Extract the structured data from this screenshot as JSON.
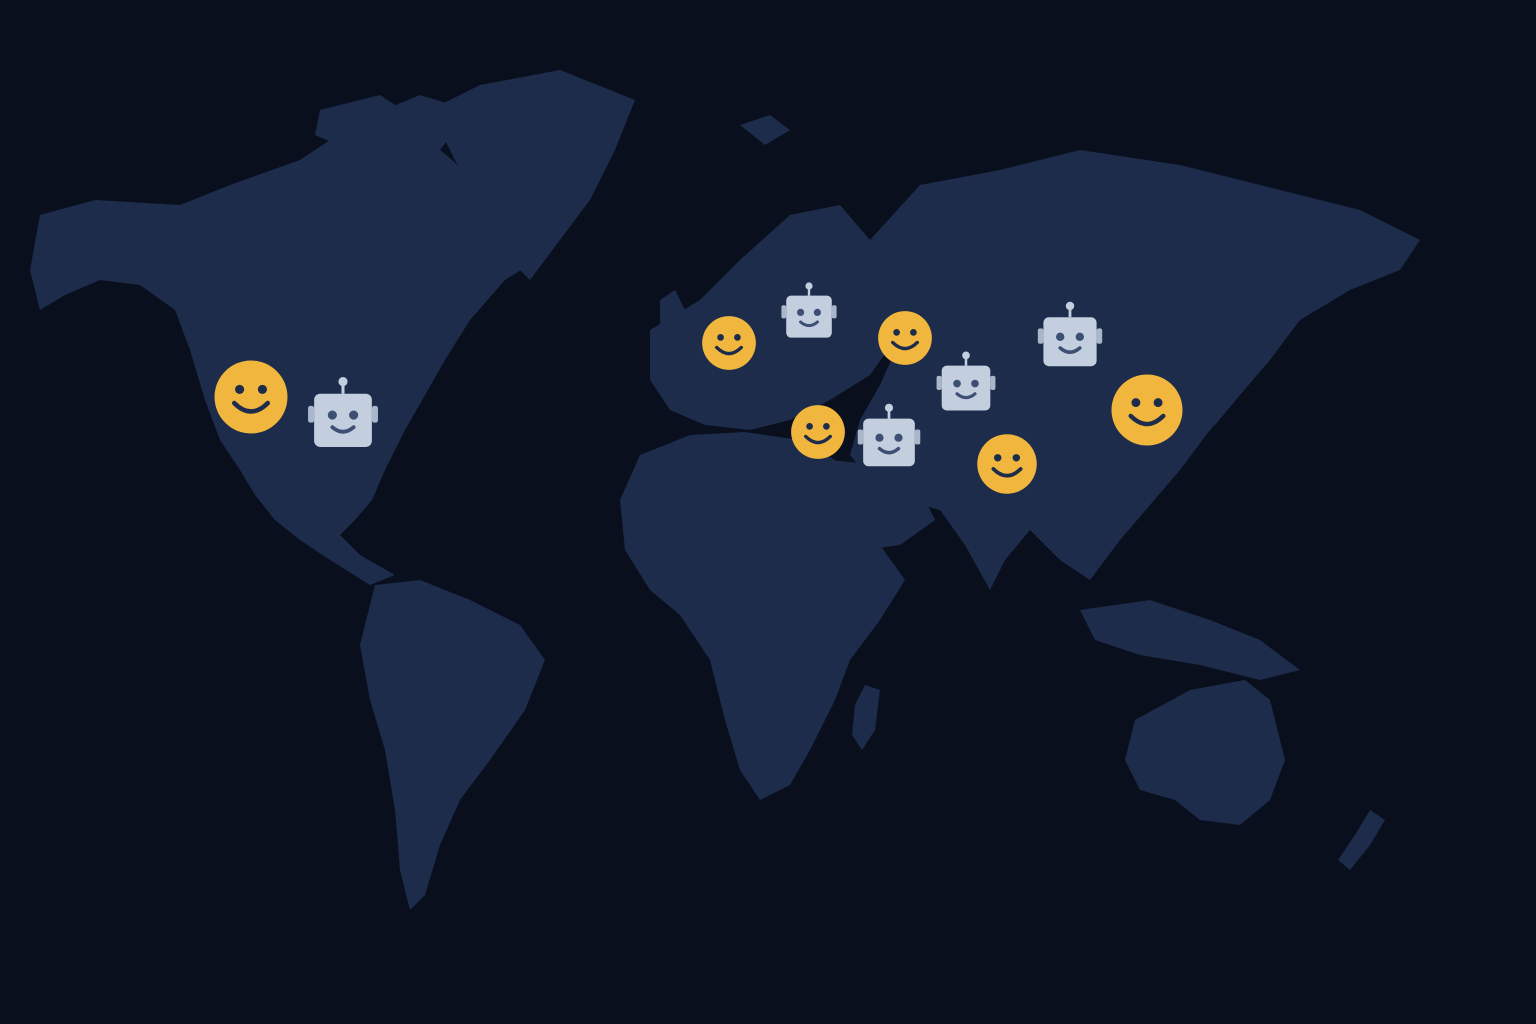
{
  "map": {
    "background_color": "#0a0f1e",
    "land_color": "#1c2c4a",
    "marker_types": {
      "human": {
        "icon": "smiley-face-icon",
        "color": "#f0b63e",
        "feature_color": "#1c2c4a"
      },
      "bot": {
        "icon": "robot-face-icon",
        "color": "#c3cfdf",
        "feature_color": "#3d4f73"
      }
    },
    "markers": [
      {
        "type": "human",
        "region": "north-america-west"
      },
      {
        "type": "bot",
        "region": "north-america-central"
      },
      {
        "type": "human",
        "region": "western-europe"
      },
      {
        "type": "bot",
        "region": "northern-europe"
      },
      {
        "type": "human",
        "region": "eastern-mediterranean"
      },
      {
        "type": "bot",
        "region": "middle-east"
      },
      {
        "type": "human",
        "region": "caspian"
      },
      {
        "type": "bot",
        "region": "central-asia"
      },
      {
        "type": "human",
        "region": "south-asia"
      },
      {
        "type": "bot",
        "region": "mongolia"
      },
      {
        "type": "human",
        "region": "east-asia"
      }
    ]
  }
}
